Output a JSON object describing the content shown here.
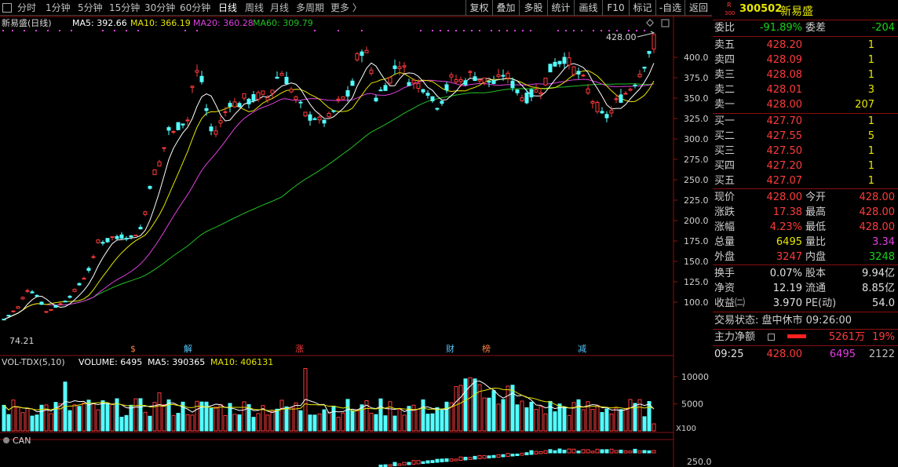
{
  "toolbar": {
    "periods": [
      "分时",
      "1分钟",
      "5分钟",
      "15分钟",
      "30分钟",
      "60分钟",
      "日线",
      "周线",
      "月线",
      "多周期",
      "更多 〉"
    ],
    "active": "日线",
    "buttons": [
      "复权",
      "叠加",
      "多股",
      "统计",
      "画线",
      "F10",
      "标记",
      "-自选",
      "返回"
    ]
  },
  "chart": {
    "title": "新易盛(日线)",
    "ma5": "MA5: 392.66",
    "ma10": "MA10: 366.19",
    "ma20": "MA20: 360.28",
    "ma60": "MA60: 309.79",
    "price_high_label": "428.00",
    "price_low_label": "74.21",
    "price_ticks": [
      "400.0",
      "375.0",
      "350.0",
      "325.0",
      "300.0",
      "275.0",
      "250.0",
      "225.0",
      "200.0",
      "175.0",
      "150.0",
      "125.0",
      "100.0"
    ],
    "markers": [
      "$",
      "解",
      "涨",
      "财",
      "榜",
      "减"
    ],
    "vol_header": "VOL-TDX(5,10)",
    "vol_volume": "VOLUME: 6495",
    "vol_ma5": "MA5: 390365",
    "vol_ma10": "MA10: 406131",
    "vol_ticks": [
      "10000",
      "5000"
    ],
    "vol_unit": "X100",
    "can_label": "CAN",
    "can_tick": "250.0",
    "colors": {
      "up": "#ff3b3b",
      "down": "#54ffff",
      "ma5": "#ffffff",
      "ma10": "#e6e600",
      "ma20": "#e040e0",
      "ma60": "#22c022"
    }
  },
  "quote": {
    "code": "300502",
    "name": "新易盛",
    "badge_top": "R",
    "badge_bottom": "300",
    "weibi_label": "委比",
    "weibi_value": "-91.89%",
    "weicha_label": "委差",
    "weicha_value": "-204",
    "asks": [
      {
        "label": "卖五",
        "price": "428.20",
        "vol": "1"
      },
      {
        "label": "卖四",
        "price": "428.09",
        "vol": "1"
      },
      {
        "label": "卖三",
        "price": "428.08",
        "vol": "1"
      },
      {
        "label": "卖二",
        "price": "428.01",
        "vol": "3"
      },
      {
        "label": "卖一",
        "price": "428.00",
        "vol": "207"
      }
    ],
    "bids": [
      {
        "label": "买一",
        "price": "427.70",
        "vol": "1"
      },
      {
        "label": "买二",
        "price": "427.55",
        "vol": "5"
      },
      {
        "label": "买三",
        "price": "427.50",
        "vol": "1"
      },
      {
        "label": "买四",
        "price": "427.20",
        "vol": "1"
      },
      {
        "label": "买五",
        "price": "427.07",
        "vol": "1"
      }
    ],
    "stats": [
      {
        "l1": "现价",
        "v1": "428.00",
        "c1": "r",
        "l2": "今开",
        "v2": "428.00",
        "c2": "r"
      },
      {
        "l1": "涨跌",
        "v1": "17.38",
        "c1": "r",
        "l2": "最高",
        "v2": "428.00",
        "c2": "r"
      },
      {
        "l1": "涨幅",
        "v1": "4.23%",
        "c1": "r",
        "l2": "最低",
        "v2": "428.00",
        "c2": "r"
      },
      {
        "l1": "总量",
        "v1": "6495",
        "c1": "y",
        "l2": "量比",
        "v2": "3.34",
        "c2": "m"
      },
      {
        "l1": "外盘",
        "v1": "3247",
        "c1": "r",
        "l2": "内盘",
        "v2": "3248",
        "c2": "g"
      }
    ],
    "stats2": [
      {
        "l1": "换手",
        "v1": "0.07%",
        "l2": "股本",
        "v2": "9.94亿"
      },
      {
        "l1": "净资",
        "v1": "12.19",
        "l2": "流通",
        "v2": "8.85亿"
      },
      {
        "l1": "收益㈡",
        "v1": "3.970",
        "l2": "PE(动)",
        "v2": "54.0"
      }
    ],
    "trade_status": "交易状态: 盘中休市 09:26:00",
    "main_flow_label": "主力净额",
    "main_flow_value": "5261万",
    "main_flow_pct": "19%",
    "tick": {
      "time": "09:25",
      "price": "428.00",
      "vol": "6495",
      "count": "2122"
    }
  }
}
